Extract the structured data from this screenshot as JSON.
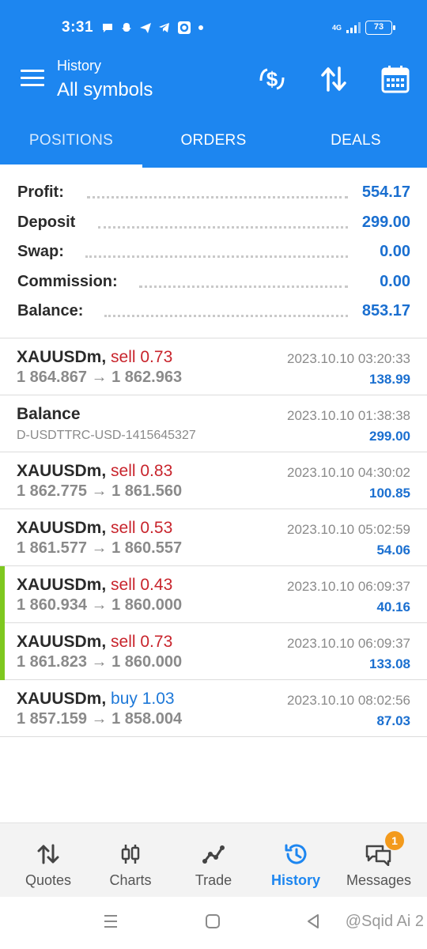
{
  "status_bar": {
    "time": "3:31",
    "network": "4G",
    "battery": "73"
  },
  "header": {
    "subtitle": "History",
    "title": "All symbols"
  },
  "tabs": [
    {
      "label": "POSITIONS",
      "active": true
    },
    {
      "label": "ORDERS",
      "active": false
    },
    {
      "label": "DEALS",
      "active": false
    }
  ],
  "summary": [
    {
      "label": "Profit:",
      "value": "554.17"
    },
    {
      "label": "Deposit",
      "value": "299.00"
    },
    {
      "label": "Swap:",
      "value": "0.00"
    },
    {
      "label": "Commission:",
      "value": "0.00"
    },
    {
      "label": "Balance:",
      "value": "853.17"
    }
  ],
  "deals": [
    {
      "symbol": "XAUUSDm,",
      "side": "sell 0.73",
      "prices": "1 864.867 → 1 862.963",
      "time": "2023.10.10 03:20:33",
      "profit": "138.99"
    },
    {
      "symbol": "Balance",
      "comment": "D-USDTTRC-USD-1415645327",
      "time": "2023.10.10 01:38:38",
      "profit": "299.00"
    },
    {
      "symbol": "XAUUSDm,",
      "side": "sell 0.83",
      "prices": "1 862.775 → 1 861.560",
      "time": "2023.10.10 04:30:02",
      "profit": "100.85"
    },
    {
      "symbol": "XAUUSDm,",
      "side": "sell 0.53",
      "prices": "1 861.577 → 1 860.557",
      "time": "2023.10.10 05:02:59",
      "profit": "54.06"
    },
    {
      "symbol": "XAUUSDm,",
      "side": "sell 0.43",
      "prices": "1 860.934 → 1 860.000",
      "time": "2023.10.10 06:09:37",
      "profit": "40.16"
    },
    {
      "symbol": "XAUUSDm,",
      "side": "sell 0.73",
      "prices": "1 861.823 → 1 860.000",
      "time": "2023.10.10 06:09:37",
      "profit": "133.08"
    },
    {
      "symbol": "XAUUSDm,",
      "side": "buy 1.03",
      "prices": "1 857.159 → 1 858.004",
      "time": "2023.10.10 08:02:56",
      "profit": "87.03"
    }
  ],
  "bottom_nav": [
    {
      "label": "Quotes",
      "icon": "quotes-icon"
    },
    {
      "label": "Charts",
      "icon": "charts-icon"
    },
    {
      "label": "Trade",
      "icon": "trade-icon"
    },
    {
      "label": "History",
      "icon": "history-icon",
      "active": true
    },
    {
      "label": "Messages",
      "icon": "messages-icon",
      "badge": "1"
    }
  ],
  "watermark": "@Sqid Ai 2",
  "colors": {
    "header": "#1d86f0",
    "profit": "#1a6fd0",
    "sell": "#c8242c",
    "buy": "#1d78d8",
    "marker": "#7ec81f",
    "badge": "#f39a1c"
  }
}
